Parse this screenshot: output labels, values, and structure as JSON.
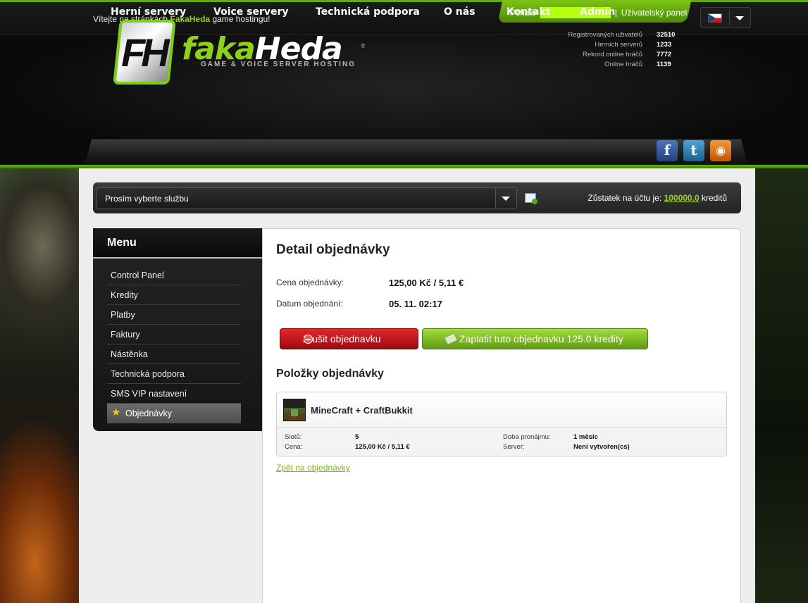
{
  "topbar": {
    "welcome_prefix": "Vítejte na stránkách",
    "welcome_brand": "FakaHeda",
    "welcome_suffix": "game hostingu!",
    "user_greeting": "Pchalo",
    "user_panel_link": "Uživatelský panel",
    "language": "cz-flag-icon"
  },
  "logo": {
    "letters": "FH",
    "word_part1": "faka",
    "word_part2": "Heda",
    "subtitle": "GAME & VOICE SERVER HOSTING",
    "reg": "®"
  },
  "stats": [
    {
      "label": "Registrovaných uživatelů",
      "value": "32510"
    },
    {
      "label": "Herních serverů",
      "value": "1233"
    },
    {
      "label": "Rekord online hráčů",
      "value": "7772"
    },
    {
      "label": "Online hráčů",
      "value": "1139"
    }
  ],
  "nav": {
    "items": [
      "Herní servery",
      "Voice servery",
      "Technická podpora",
      "O nás",
      "Kontakt",
      "Admin"
    ],
    "social": [
      "facebook-icon",
      "twitter-icon",
      "rss-icon"
    ]
  },
  "service_bar": {
    "select_text": "Prosím vyberte službu",
    "balance_prefix": "Zůstatek na účtu je:",
    "balance_value": "100000.0",
    "balance_suffix": "kreditů"
  },
  "sidebar": {
    "title": "Menu",
    "items": [
      "Control Panel",
      "Kredity",
      "Platby",
      "Faktury",
      "Nástěnka",
      "Technická podpora",
      "SMS VIP nastavení",
      "Objednávky"
    ],
    "active_index": 7
  },
  "order": {
    "title": "Detail objednávky",
    "price_label": "Cena objednávky:",
    "price_value": "125,00 Kč / 5,11 €",
    "date_label": "Datum objednání:",
    "date_value": "05. 11. 02:17",
    "cancel_button": "Zrušit objednavku",
    "pay_button": "Zaplatit tuto objednavku 125.0 kredity",
    "items_title": "Položky objednávky",
    "item": {
      "name": "MineCraft + CraftBukkit",
      "slots_label": "Slotů:",
      "slots_value": "5",
      "price_label": "Cena:",
      "price_value": "125,00 Kč  / 5,11 €",
      "rental_label": "Doba pronájmu:",
      "rental_value": "1 měsíc",
      "server_label": "Server:",
      "server_value": "Není vytvořen(cs)"
    },
    "back_link": "Zpět na objednávky"
  },
  "colors": {
    "accent_green": "#8fd11a",
    "cancel_red": "#c0141a",
    "pay_green": "#7cc414"
  }
}
